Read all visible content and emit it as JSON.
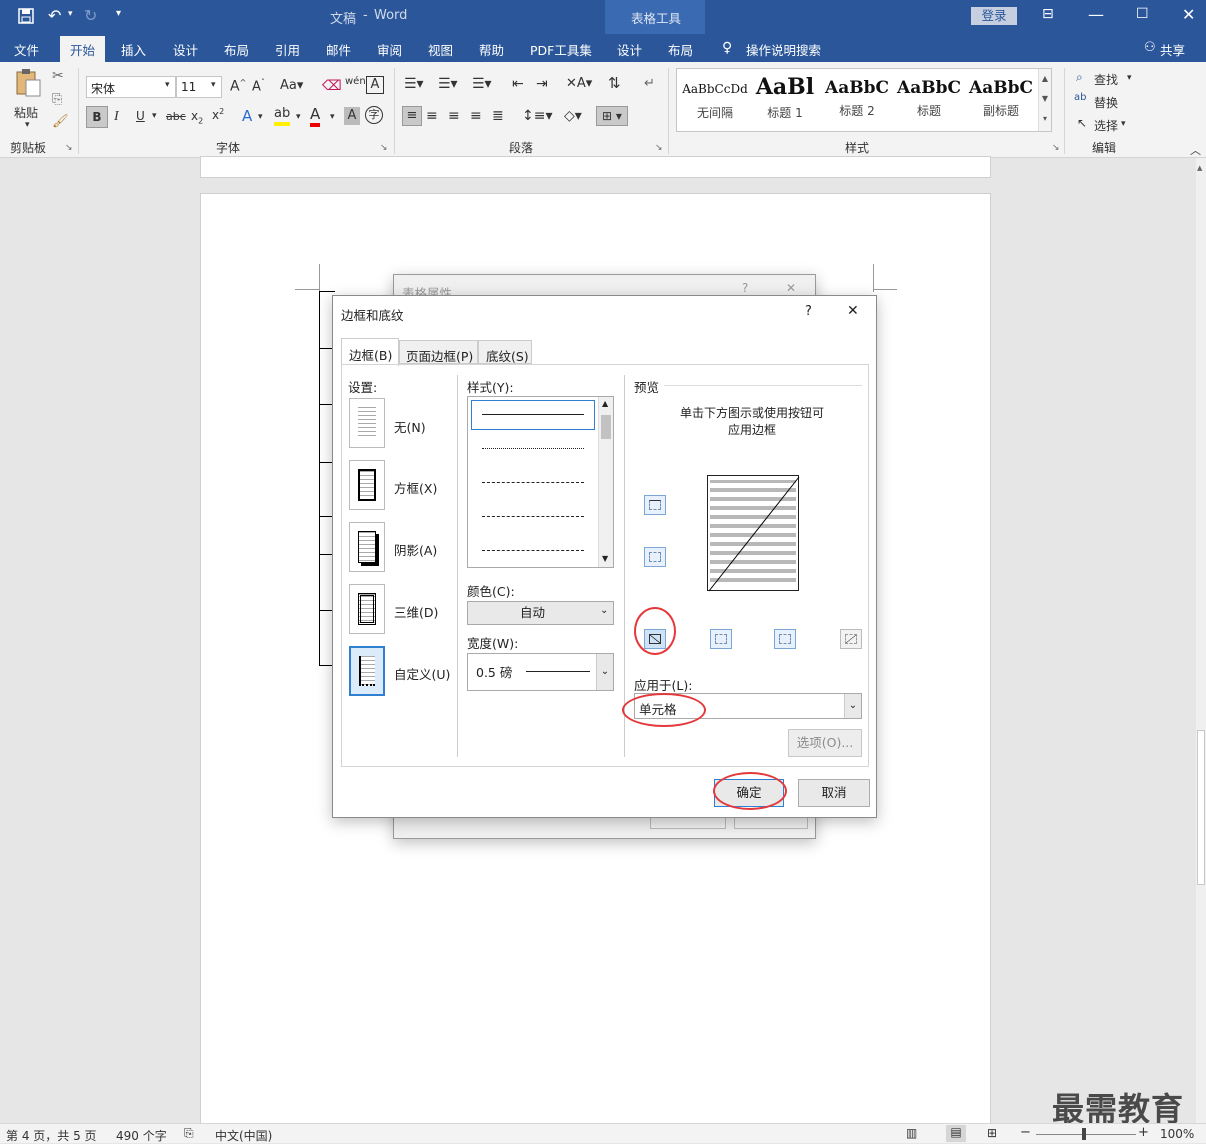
{
  "window": {
    "doc_title": "文稿",
    "sep": "-",
    "app": "Word",
    "context_tab": "表格工具",
    "login": "登录"
  },
  "tabs": [
    {
      "label": "文件"
    },
    {
      "label": "开始"
    },
    {
      "label": "插入"
    },
    {
      "label": "设计"
    },
    {
      "label": "布局"
    },
    {
      "label": "引用"
    },
    {
      "label": "邮件"
    },
    {
      "label": "审阅"
    },
    {
      "label": "视图"
    },
    {
      "label": "帮助"
    },
    {
      "label": "PDF工具集"
    },
    {
      "label": "设计"
    },
    {
      "label": "布局"
    }
  ],
  "tell_me": "操作说明搜索",
  "share": "共享",
  "ribbon": {
    "paste": "粘贴",
    "clipboard": "剪贴板",
    "font_name": "宋体",
    "font_size": "11",
    "font_group": "字体",
    "para_group": "段落",
    "styles_group": "样式",
    "edit_group": "编辑",
    "find": "查找",
    "replace": "替换",
    "select": "选择",
    "bold": "B",
    "italic": "I",
    "underline": "U",
    "strike": "abc",
    "styles": [
      {
        "sample": "AaBbCcDd",
        "name": "无间隔"
      },
      {
        "sample": "AaBl",
        "name": "标题 1"
      },
      {
        "sample": "AaBbC",
        "name": "标题 2"
      },
      {
        "sample": "AaBbC",
        "name": "标题"
      },
      {
        "sample": "AaBbC",
        "name": "副标题"
      }
    ]
  },
  "back_dialog": {
    "title": "表格属性",
    "help": "?",
    "close": "✕"
  },
  "dialog": {
    "title": "边框和底纹",
    "help": "?",
    "close": "✕",
    "tabs": [
      {
        "label": "边框(B)"
      },
      {
        "label": "页面边框(P)"
      },
      {
        "label": "底纹(S)"
      }
    ],
    "settings_label": "设置:",
    "settings": [
      {
        "label": "无(N)"
      },
      {
        "label": "方框(X)"
      },
      {
        "label": "阴影(A)"
      },
      {
        "label": "三维(D)"
      },
      {
        "label": "自定义(U)"
      }
    ],
    "style_label": "样式(Y):",
    "color_label": "颜色(C):",
    "color_value": "自动",
    "width_label": "宽度(W):",
    "width_value": "0.5 磅",
    "preview_label": "预览",
    "preview_hint_1": "单击下方图示或使用按钮可",
    "preview_hint_2": "应用边框",
    "apply_label": "应用于(L):",
    "apply_value": "单元格",
    "options": "选项(O)...",
    "ok": "确定",
    "cancel": "取消"
  },
  "status": {
    "page": "第 4 页，共 5 页",
    "words": "490 个字",
    "lang": "中文(中国)",
    "zoom": "100%"
  },
  "watermark": "最需教育"
}
